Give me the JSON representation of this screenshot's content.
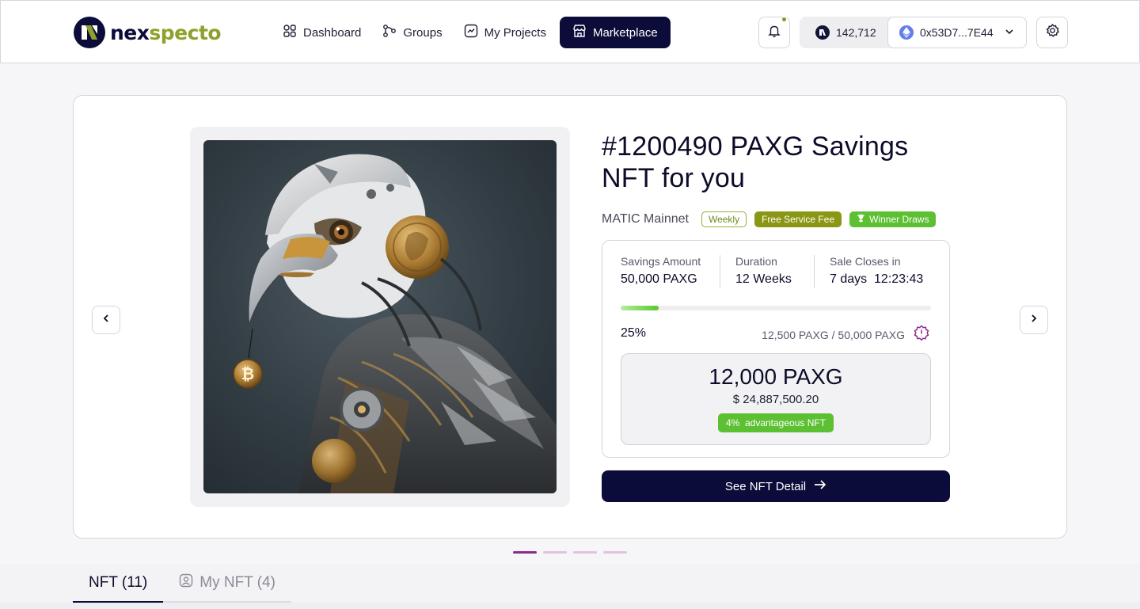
{
  "header": {
    "logo": {
      "prefix": "nex",
      "accent": "s",
      "suffix": "pecto"
    },
    "nav": [
      {
        "label": "Dashboard",
        "icon": "dashboard-icon",
        "active": false
      },
      {
        "label": "Groups",
        "icon": "groups-icon",
        "active": false
      },
      {
        "label": "My Projects",
        "icon": "projects-icon",
        "active": false
      },
      {
        "label": "Marketplace",
        "icon": "marketplace-icon",
        "active": true
      }
    ],
    "balance": "142,712",
    "wallet_address": "0x53D7...7E44"
  },
  "nft": {
    "title": "#1200490 PAXG Savings NFT for you",
    "network": "MATIC Mainnet",
    "badges": {
      "weekly": "Weekly",
      "fee": "Free Service Fee",
      "winner": "Winner Draws"
    },
    "stats": [
      {
        "label": "Savings Amount",
        "value": "50,000 PAXG"
      },
      {
        "label": "Duration",
        "value": "12 Weeks"
      },
      {
        "label": "Sale Closes in",
        "value": "7 days  12:23:43"
      }
    ],
    "progress_percent": 12.25,
    "percent_label": "25%",
    "raised_label": "12,500 PAXG / 50,000 PAXG",
    "price": "12,000 PAXG",
    "price_usd": "$ 24,887,500.20",
    "advantage": "4%  advantageous NFT",
    "cta": "See NFT Detail"
  },
  "carousel": {
    "slide_count": 4,
    "active_slide": 0
  },
  "tabs": [
    {
      "label": "NFT (11)",
      "active": true
    },
    {
      "label": "My NFT (4)",
      "active": false,
      "icon": "user-badge-icon"
    }
  ],
  "colors": {
    "navy": "#0c0c3a",
    "brand_green": "#8ea12c",
    "success_green": "#5cc032",
    "olive": "#8a9714",
    "carousel_dot": "#8d2a8d"
  }
}
